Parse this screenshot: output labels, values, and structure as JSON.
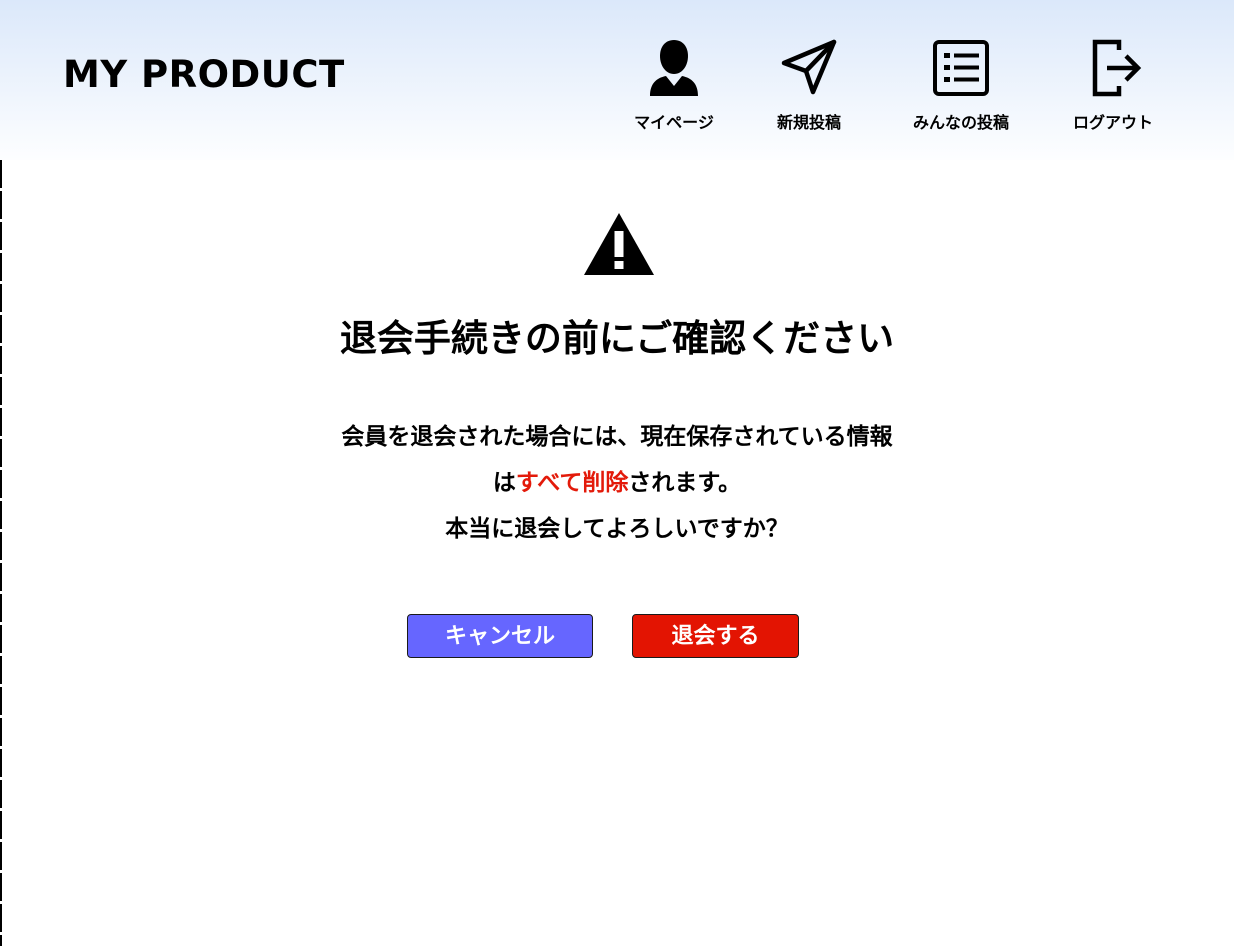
{
  "header": {
    "logo": "MY PRODUCT",
    "nav": [
      {
        "label": "マイページ",
        "icon": "user-icon"
      },
      {
        "label": "新規投稿",
        "icon": "paper-plane-icon"
      },
      {
        "label": "みんなの投稿",
        "icon": "list-icon"
      },
      {
        "label": "ログアウト",
        "icon": "logout-icon"
      }
    ]
  },
  "main": {
    "warning_icon": "warning-icon",
    "title": "退会手続きの前にご確認ください",
    "message": {
      "line1": "会員を退会された場合には、現在保存されている情報",
      "line2_prefix": "は",
      "line2_highlight": "すべて削除",
      "line2_suffix": "されます。",
      "line3": "本当に退会してよろしいですか？"
    },
    "buttons": {
      "cancel": "キャンセル",
      "withdraw": "退会する"
    }
  },
  "colors": {
    "header_gradient_top": "#dbe8fa",
    "header_gradient_bottom": "#fdfeff",
    "highlight": "#e31a0a",
    "cancel_button": "#6666ff",
    "withdraw_button": "#e31402"
  }
}
